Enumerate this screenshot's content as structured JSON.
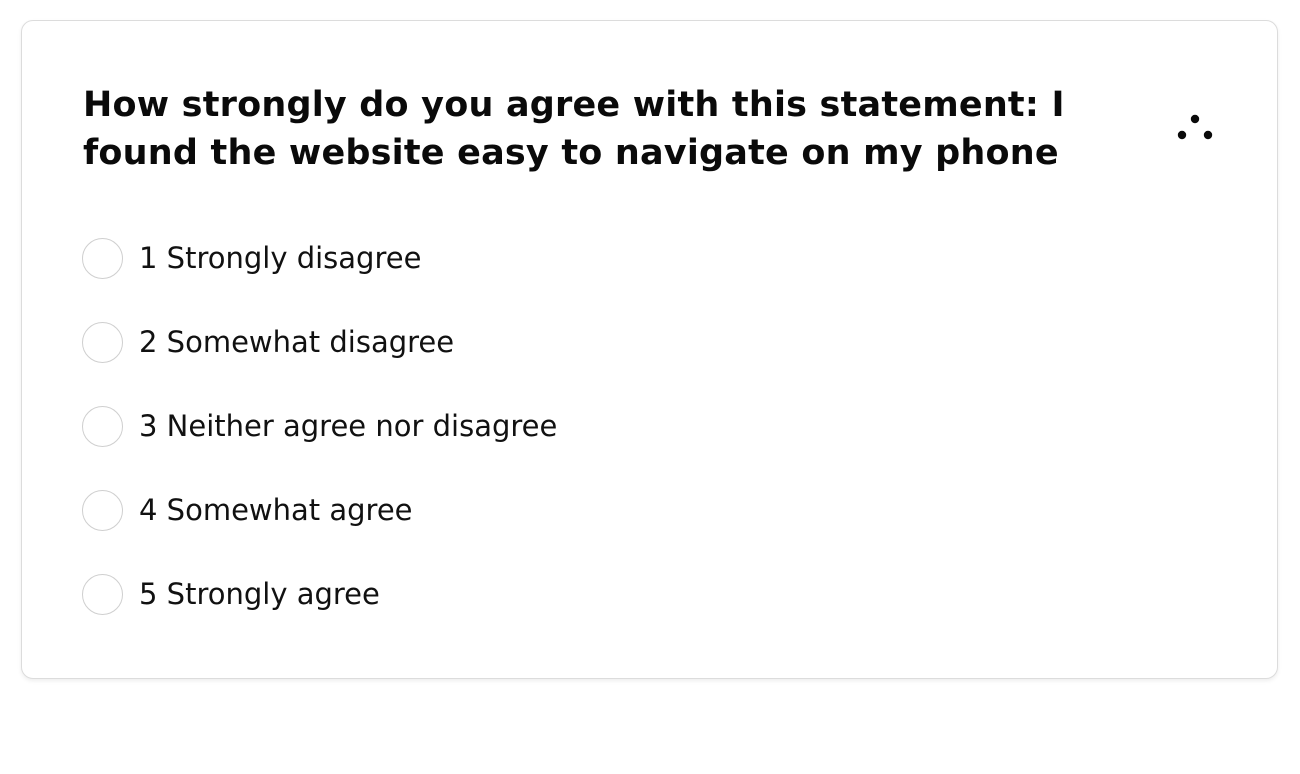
{
  "question": {
    "text": "How strongly do you agree with this statement: I found the website easy to navigate on my phone",
    "logo_icon": "three-dot-cluster-icon"
  },
  "options": [
    {
      "label": "1 Strongly disagree",
      "selected": false
    },
    {
      "label": "2 Somewhat disagree",
      "selected": false
    },
    {
      "label": "3 Neither agree nor disagree",
      "selected": false
    },
    {
      "label": "4 Somewhat agree",
      "selected": false
    },
    {
      "label": "5 Strongly agree",
      "selected": false
    }
  ],
  "colors": {
    "text": "#0a0a0a",
    "radio_border": "#cfcfcf",
    "card_border": "#dcdcdc",
    "background": "#ffffff"
  }
}
